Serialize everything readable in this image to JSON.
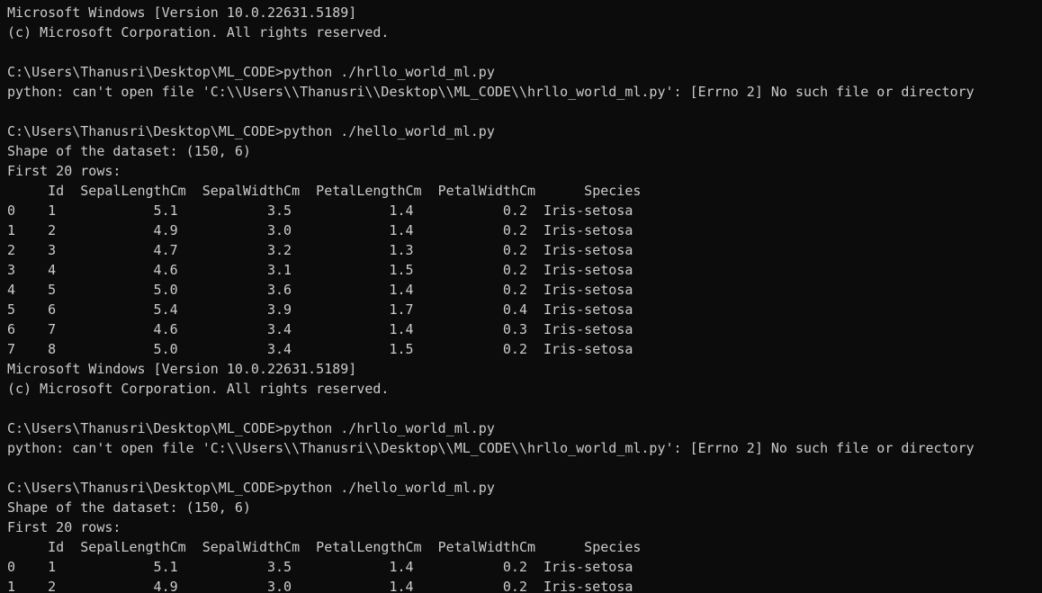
{
  "terminal": {
    "lines": [
      "Microsoft Windows [Version 10.0.22631.5189]",
      "(c) Microsoft Corporation. All rights reserved.",
      "",
      "C:\\Users\\Thanusri\\Desktop\\ML_CODE>python ./hrllo_world_ml.py",
      "python: can't open file 'C:\\\\Users\\\\Thanusri\\\\Desktop\\\\ML_CODE\\\\hrllo_world_ml.py': [Errno 2] No such file or directory",
      "",
      "C:\\Users\\Thanusri\\Desktop\\ML_CODE>python ./hello_world_ml.py",
      "Shape of the dataset: (150, 6)",
      "First 20 rows:",
      "     Id  SepalLengthCm  SepalWidthCm  PetalLengthCm  PetalWidthCm      Species",
      "0    1            5.1           3.5            1.4           0.2  Iris-setosa",
      "1    2            4.9           3.0            1.4           0.2  Iris-setosa",
      "2    3            4.7           3.2            1.3           0.2  Iris-setosa",
      "3    4            4.6           3.1            1.5           0.2  Iris-setosa",
      "4    5            5.0           3.6            1.4           0.2  Iris-setosa",
      "5    6            5.4           3.9            1.7           0.4  Iris-setosa",
      "6    7            4.6           3.4            1.4           0.3  Iris-setosa",
      "7    8            5.0           3.4            1.5           0.2  Iris-setosa",
      "Microsoft Windows [Version 10.0.22631.5189]",
      "(c) Microsoft Corporation. All rights reserved.",
      "",
      "C:\\Users\\Thanusri\\Desktop\\ML_CODE>python ./hrllo_world_ml.py",
      "python: can't open file 'C:\\\\Users\\\\Thanusri\\\\Desktop\\\\ML_CODE\\\\hrllo_world_ml.py': [Errno 2] No such file or directory",
      "",
      "C:\\Users\\Thanusri\\Desktop\\ML_CODE>python ./hello_world_ml.py",
      "Shape of the dataset: (150, 6)",
      "First 20 rows:",
      "     Id  SepalLengthCm  SepalWidthCm  PetalLengthCm  PetalWidthCm      Species",
      "0    1            5.1           3.5            1.4           0.2  Iris-setosa",
      "1    2            4.9           3.0            1.4           0.2  Iris-setosa"
    ]
  },
  "colors": {
    "background": "#0c0c0c",
    "foreground": "#cccccc"
  }
}
